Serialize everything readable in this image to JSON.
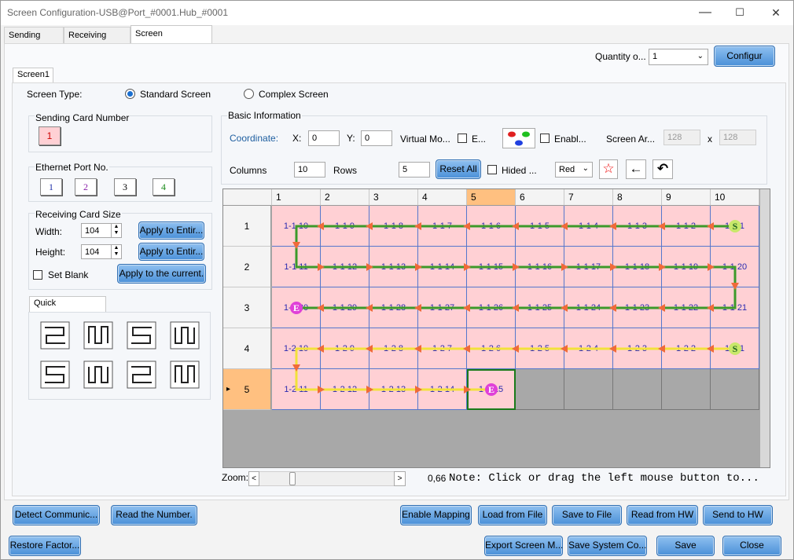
{
  "window": {
    "title": "Screen Configuration-USB@Port_#0001.Hub_#0001",
    "min": "—",
    "max": "☐",
    "close": "✕"
  },
  "tabs": [
    "Sending Card",
    "Receiving Card",
    "Screen Connection"
  ],
  "quantity": {
    "label": "Quantity o...",
    "value": "1",
    "configure": "Configur"
  },
  "screen_tab": "Screen1",
  "screen_type": {
    "label": "Screen Type:",
    "standard": "Standard Screen",
    "complex": "Complex Screen"
  },
  "sending_card": {
    "title": "Sending Card Number",
    "value": "1"
  },
  "ethernet": {
    "title": "Ethernet Port No.",
    "ports": [
      "1",
      "2",
      "3",
      "4"
    ]
  },
  "receiving_size": {
    "title": "Receiving Card Size",
    "width_label": "Width:",
    "width": "104",
    "height_label": "Height:",
    "height": "104",
    "apply_entire": "Apply to Entir...",
    "set_blank": "Set Blank",
    "apply_current": "Apply to the current."
  },
  "quick": {
    "title": "Quick Connection"
  },
  "basic": {
    "title": "Basic Information",
    "coordinate": "Coordinate:",
    "x_label": "X:",
    "x": "0",
    "y_label": "Y:",
    "y": "0",
    "virtual": "Virtual Mo...",
    "e": "E...",
    "enable": "Enabl...",
    "screen_area": "Screen Ar...",
    "area_w": "128",
    "x_sep": "x",
    "area_h": "128",
    "columns_label": "Columns",
    "columns": "10",
    "rows_label": "Rows",
    "rows": "5",
    "reset_all": "Reset All",
    "hided": "Hided ...",
    "color": "Red"
  },
  "grid": {
    "cols": [
      "1",
      "2",
      "3",
      "4",
      "5",
      "6",
      "7",
      "8",
      "9",
      "10"
    ],
    "rows": [
      "1",
      "2",
      "3",
      "4",
      "5"
    ],
    "cells": [
      [
        "1-1 10",
        "1-1 9",
        "1-1 8",
        "1-1 7",
        "1-1 6",
        "1-1 5",
        "1-1 4",
        "1-1 3",
        "1-1 2",
        "1-1 1"
      ],
      [
        "1-1 11",
        "1-1 12",
        "1-1 13",
        "1-1 14",
        "1-1 15",
        "1-1 16",
        "1-1 17",
        "1-1 18",
        "1-1 19",
        "1-1 20"
      ],
      [
        "1-1 30",
        "1-1 29",
        "1-1 28",
        "1-1 27",
        "1-1 26",
        "1-1 25",
        "1-1 24",
        "1-1 23",
        "1-1 22",
        "1-1 21"
      ],
      [
        "1-2 10",
        "1-2 9",
        "1-2 8",
        "1-2 7",
        "1-2 6",
        "1-2 5",
        "1-2 4",
        "1-2 3",
        "1-2 2",
        "1-2 1"
      ],
      [
        "1-2 11",
        "1-2 12",
        "1-2 13",
        "1-2 14",
        "1-2 15",
        "",
        "",
        "",
        "",
        ""
      ]
    ],
    "start": "S",
    "end": "E"
  },
  "zoom": {
    "label": "Zoom:",
    "left": "<",
    "right": ">",
    "value": "0,66",
    "note": "Note: Click or drag the left mouse button to..."
  },
  "buttons": {
    "detect": "Detect Communic...",
    "read_number": "Read the Number.",
    "enable_mapping": "Enable Mapping",
    "load_file": "Load from File",
    "save_file": "Save to File",
    "read_hw": "Read from HW",
    "send_hw": "Send to HW",
    "restore": "Restore Factor...",
    "export": "Export Screen M...",
    "save_system": "Save System Co...",
    "save": "Save",
    "close": "Close"
  }
}
